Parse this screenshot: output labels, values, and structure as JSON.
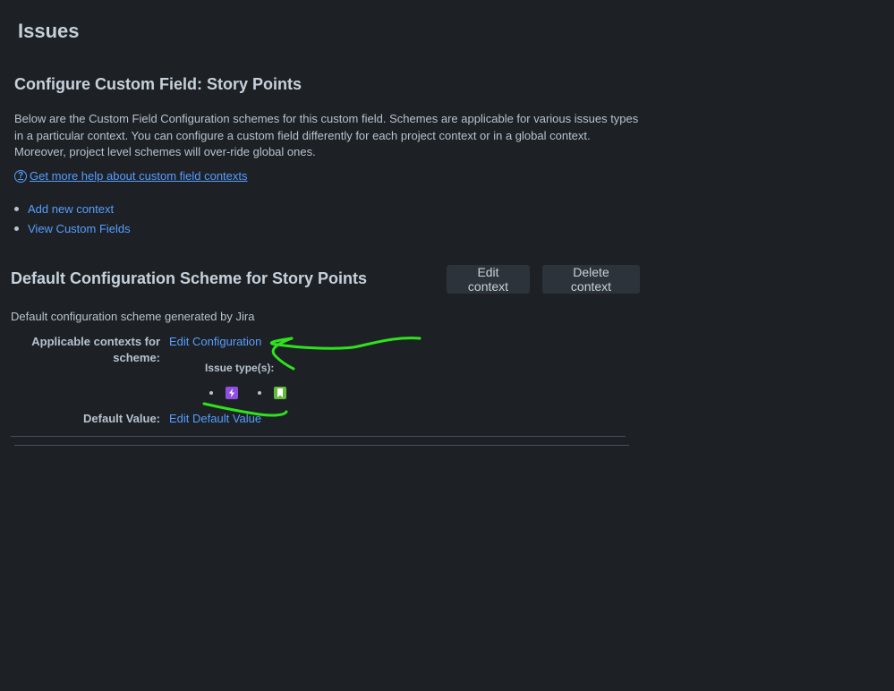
{
  "header": {
    "title": "Issues"
  },
  "config": {
    "title": "Configure Custom Field: Story Points",
    "description": "Below are the Custom Field Configuration schemes for this custom field. Schemes are applicable for various issues types in a particular context. You can configure a custom field differently for each project context or in a global context. Moreover, project level schemes will over-ride global ones.",
    "help_link": "Get more help about custom field contexts",
    "links": [
      {
        "label": "Add new context"
      },
      {
        "label": "View Custom Fields"
      }
    ]
  },
  "scheme": {
    "title": "Default Configuration Scheme for Story Points",
    "edit_context_label": "Edit context",
    "delete_context_label": "Delete context",
    "description": "Default configuration scheme generated by Jira",
    "contexts_label": "Applicable contexts for scheme:",
    "edit_configuration_label": "Edit Configuration",
    "issue_types_label": "Issue type(s):",
    "issue_types": [
      {
        "icon": "epic-icon",
        "color": "#904ee2"
      },
      {
        "icon": "story-icon",
        "color": "#63ba3c"
      }
    ],
    "default_value_label": "Default Value:",
    "edit_default_label": "Edit Default Value"
  },
  "colors": {
    "background": "#1d2125",
    "link": "#579dff",
    "annotation": "#2ee31c"
  }
}
